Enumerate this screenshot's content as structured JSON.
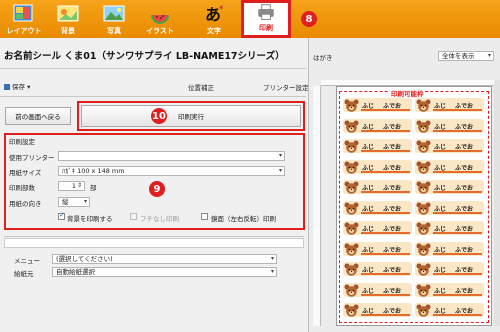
{
  "toolbar": {
    "items": [
      {
        "label": "レイアウト",
        "icon": "layout-icon"
      },
      {
        "label": "背景",
        "icon": "background-icon"
      },
      {
        "label": "写真",
        "icon": "photo-icon"
      },
      {
        "label": "イラスト",
        "icon": "illustration-icon"
      },
      {
        "label": "文字",
        "icon": "text-icon"
      },
      {
        "label": "印刷",
        "icon": "printer-icon"
      }
    ],
    "active_index": 5,
    "callout_8": "8"
  },
  "title": "お名前シール くま01（サンワサプライ LB-NAME17シリーズ）",
  "menu": {
    "save": "保存",
    "position_adjust": "位置補正",
    "printer_settings": "プリンター設定"
  },
  "buttons": {
    "back": "前の画面へ戻る",
    "print": "印刷実行",
    "callout_10": "10"
  },
  "print_settings": {
    "heading": "印刷設定",
    "printer_label": "使用プリンター",
    "printer_value": "",
    "paper_size_label": "用紙サイズ",
    "paper_size_value": "ﾊｶﾞｷ 100 x 148 mm",
    "copies_label": "印刷部数",
    "copies_value": "1",
    "copies_unit": "部",
    "orientation_label": "用紙の向き",
    "orientation_value": "縦",
    "print_background": "背景を印刷する",
    "print_background_checked": true,
    "borderless": "フチなし印刷",
    "borderless_checked": false,
    "mirror": "鏡面（左右反転）印刷",
    "mirror_checked": false,
    "callout_9": "9"
  },
  "lower": {
    "menu_label": "メニュー",
    "menu_value": "(選択してください)",
    "feed_label": "給紙元",
    "feed_value": "自動給紙選択"
  },
  "preview": {
    "paper_label": "はがき",
    "view_select": "全体を表示",
    "printable_area": "印刷可能枠",
    "name_short": "ふじ",
    "name_long": "ふでお",
    "rows": 11
  },
  "colors": {
    "toolbar": "#f39a0f",
    "accent_red": "#e01e1e",
    "label_bg": "#fbe7c5",
    "underline": "#e36b2c"
  }
}
